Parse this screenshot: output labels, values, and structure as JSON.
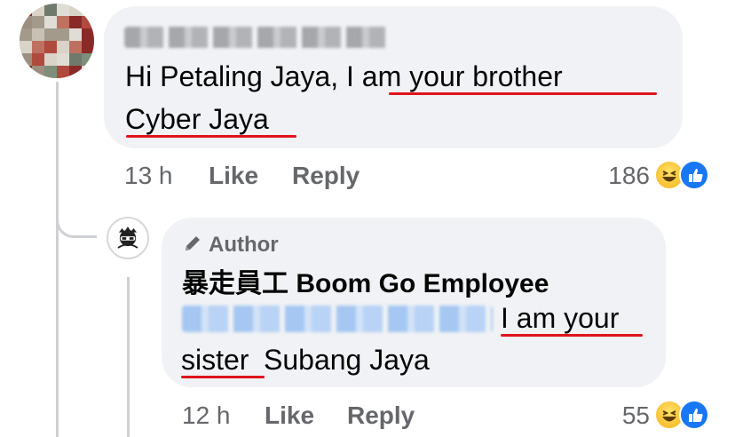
{
  "comment": {
    "author_name": "Joshua Hoo Yi Peng",
    "text_line1": "Hi Petaling Jaya, I am your  brother",
    "text_line2": "Cyber Jaya",
    "time": "13 h",
    "like_label": "Like",
    "reply_label": "Reply",
    "reaction_count": "186",
    "reactions": [
      "haha-icon",
      "like-icon"
    ]
  },
  "reply": {
    "badge": "Author",
    "author_name": "暴走員工 Boom Go Employee",
    "mention": "Joshua Hoo Yi Peng",
    "text_line1": "I am your",
    "text_line2_a": "sister",
    "text_line2_b": " Subang Jaya",
    "time": "12 h",
    "like_label": "Like",
    "reply_label": "Reply",
    "reaction_count": "55",
    "reactions": [
      "haha-icon",
      "like-icon"
    ]
  },
  "colors": {
    "bubble": "#f0f2f5",
    "meta": "#65676b",
    "underline": "#e1131a",
    "like_blue": "#1877f2",
    "mention_blur": "#b3d0f5"
  }
}
